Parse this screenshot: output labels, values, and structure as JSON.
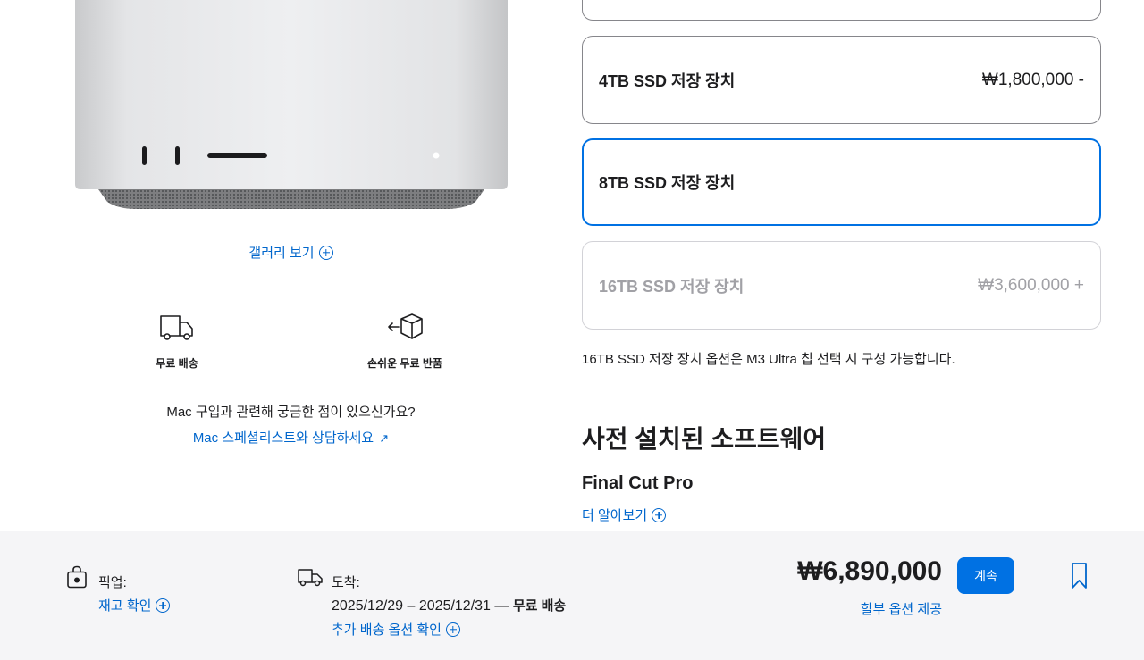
{
  "gallery": {
    "label": "갤러리 보기"
  },
  "benefits": {
    "shipping_label": "무료 배송",
    "returns_label": "손쉬운 무료 반품"
  },
  "help": {
    "question": "Mac 구입과 관련해 궁금한 점이 있으신가요?",
    "link": "Mac 스페셜리스트와 상담하세요",
    "link_icon": "↗"
  },
  "storage": {
    "options": [
      {
        "name": "4TB SSD 저장 장치",
        "price": "₩1,800,000 -"
      },
      {
        "name": "8TB SSD 저장 장치",
        "price": ""
      },
      {
        "name": "16TB SSD 저장 장치",
        "price": "₩3,600,000 +"
      }
    ],
    "selected": "8TB SSD 저장 장치",
    "note": "16TB SSD 저장 장치 옵션은 M3 Ultra 칩 선택 시 구성 가능합니다."
  },
  "software": {
    "heading": "사전 설치된 소프트웨어",
    "name": "Final Cut Pro",
    "learn_more": "더 알아보기"
  },
  "summary": {
    "pickup_label": "픽업:",
    "pickup_link": "재고 확인",
    "delivery_label": "도착:",
    "delivery_dates": "2025/12/29 – 2025/12/31 — ",
    "delivery_free": "무료 배송",
    "delivery_link": "추가 배송 옵션 확인",
    "total": "₩6,890,000",
    "installment": "할부 옵션 제공",
    "continue": "계속"
  },
  "colors": {
    "accent": "#0071e3",
    "link": "#0066cc",
    "summary_bg": "#f5f5f7"
  }
}
